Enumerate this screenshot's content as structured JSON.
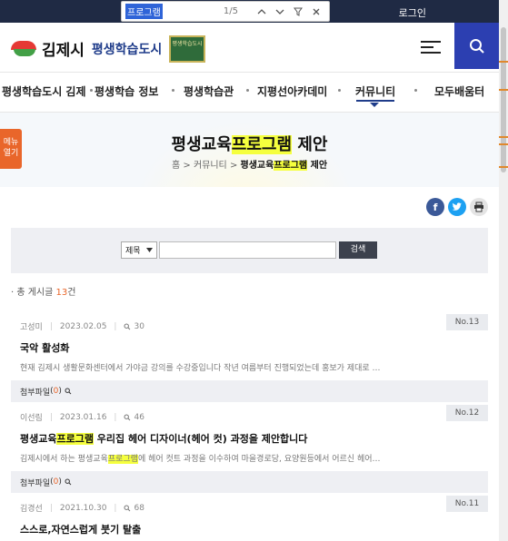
{
  "findbar": {
    "query": "프로그램",
    "count": "1/5",
    "prev_icon": "chevron-up-icon",
    "next_icon": "chevron-down-icon",
    "filter_icon": "filter-icon",
    "close_icon": "close-icon"
  },
  "topbar": {
    "login_label": "로그인"
  },
  "header": {
    "logo_city": "김제시",
    "logo_sub": "평생학습도시",
    "badge_text": "평생학습도시",
    "menu_icon": "hamburger-icon",
    "search_icon": "search-icon"
  },
  "nav": {
    "items": [
      {
        "label": "평생학습도시 김제"
      },
      {
        "label": "평생학습 정보"
      },
      {
        "label": "평생학습관"
      },
      {
        "label": "지평선아카데미"
      },
      {
        "label": "커뮤니티"
      },
      {
        "label": "모두배움터"
      }
    ],
    "active": "커뮤니티"
  },
  "banner": {
    "title_pre": "평생교육",
    "title_hl": "프로그램",
    "title_post": " 제안",
    "crumb_home": "홈",
    "crumb_sep": ">",
    "crumb_1": "커뮤니티",
    "crumb_2_pre": "평생교육",
    "crumb_2_hl": "프로그램",
    "crumb_2_post": " 제안"
  },
  "side_menu": {
    "line1": "메뉴",
    "line2": "열기"
  },
  "share": {
    "facebook": "f",
    "twitter": "t",
    "print": "⎙"
  },
  "search": {
    "select_value": "제목",
    "input_value": "",
    "button_label": "검색"
  },
  "total": {
    "prefix": "· 총 게시글 ",
    "count": "13",
    "suffix": "건"
  },
  "posts": [
    {
      "author": "고성미",
      "date": "2023.02.05",
      "views": "30",
      "no": "No.13",
      "title": "국악 활성화",
      "summary": "현재 김제시 생활문화센터에서 가야금 강의를 수강중입니다 작년 여름부터 진행되었는데 홍보가 제대로 …",
      "attach_label": "첨부파일",
      "attach_count": "0"
    },
    {
      "author": "이선림",
      "date": "2023.01.16",
      "views": "46",
      "no": "No.12",
      "title_pre": "평생교육",
      "title_hl": "프로그램",
      "title_post": " 우리집 헤어 디자이너(헤어 컷) 과정을 제안합니다",
      "summary_pre": "김제시에서 하는 평생교육",
      "summary_hl": "프로그램",
      "summary_post": "에 헤어 컷트 과정을 이수하여 마을경로당, 요양원등에서 어르신 헤어…",
      "attach_label": "첨부파일",
      "attach_count": "0"
    },
    {
      "author": "김경선",
      "date": "2021.10.30",
      "views": "68",
      "no": "No.11",
      "title": "스스로,자연스럽게 붓기 탈출"
    }
  ]
}
